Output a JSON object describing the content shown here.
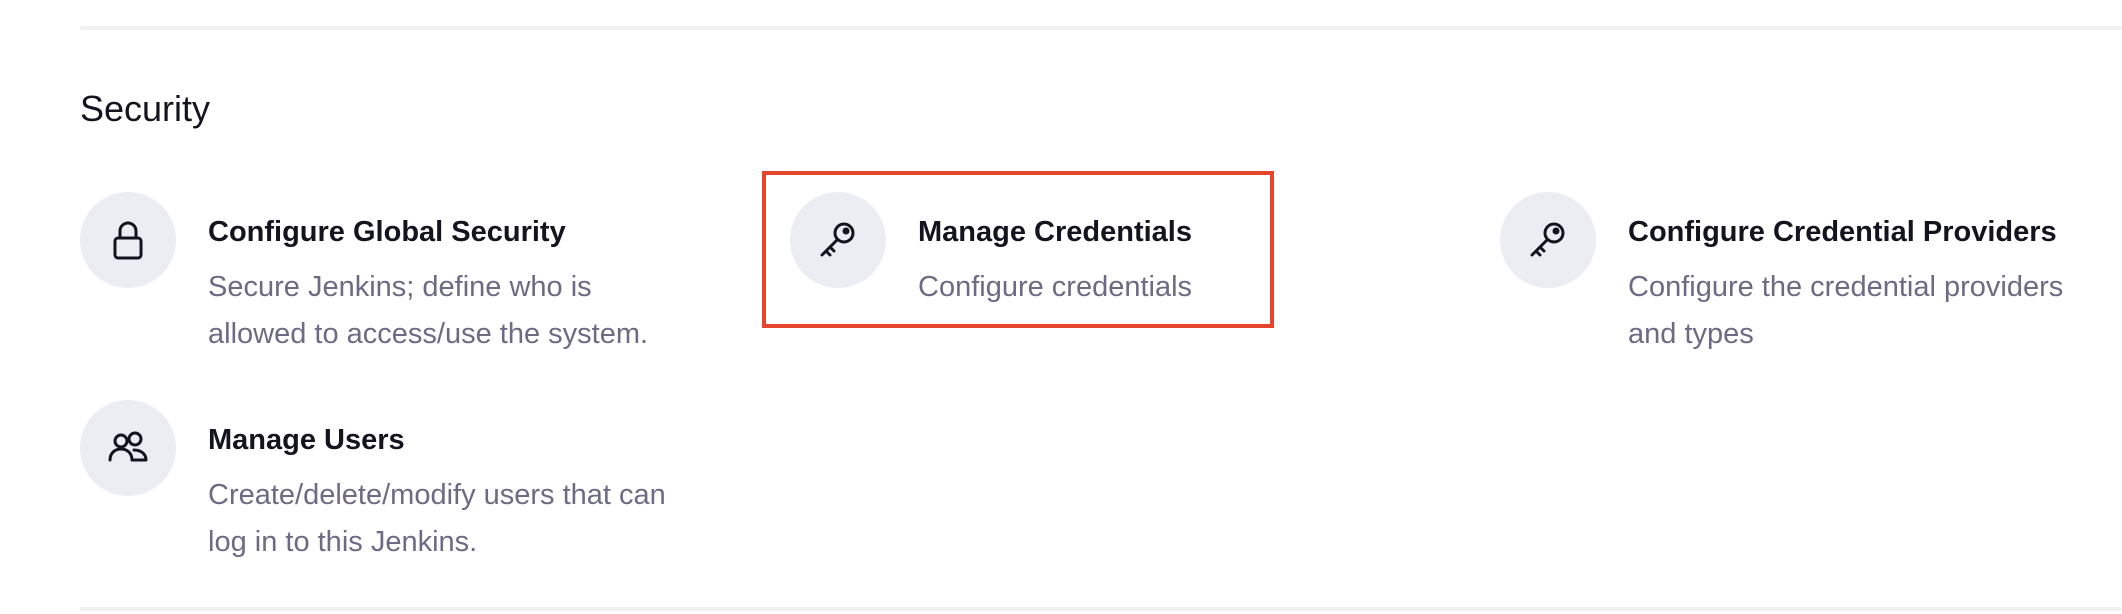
{
  "section": {
    "title": "Security"
  },
  "items": [
    {
      "title": "Configure Global Security",
      "desc_line1": "Secure Jenkins; define who is",
      "desc_line2": "allowed to access/use the system.",
      "icon": "lock-icon"
    },
    {
      "title": "Manage Credentials",
      "desc_line1": "Configure credentials",
      "icon": "key-icon",
      "highlighted": true
    },
    {
      "title": "Configure Credential Providers",
      "desc_line1": "Configure the credential providers",
      "desc_line2": "and types",
      "icon": "key-icon"
    },
    {
      "title": "Manage Users",
      "desc_line1": "Create/delete/modify users that can",
      "desc_line2": "log in to this Jenkins.",
      "icon": "users-icon"
    }
  ],
  "colors": {
    "highlight": "#e5452d",
    "icon_bg": "#ecedf2",
    "description": "#6d6b83",
    "title": "#14141f"
  }
}
